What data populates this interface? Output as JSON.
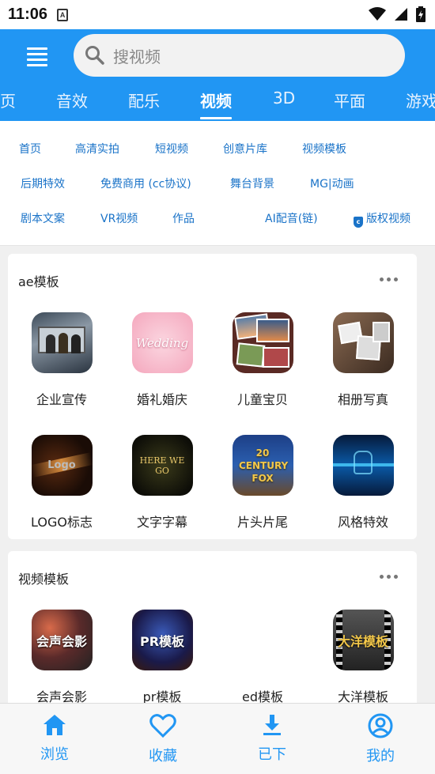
{
  "status_bar": {
    "time": "11:06",
    "app_icon_letter": "A"
  },
  "search": {
    "placeholder": "搜视频"
  },
  "tabs": [
    {
      "label": "页"
    },
    {
      "label": "音效"
    },
    {
      "label": "配乐"
    },
    {
      "label": "视频",
      "active": true
    },
    {
      "label": "3D"
    },
    {
      "label": "平面"
    },
    {
      "label": "游戏"
    }
  ],
  "categories": [
    {
      "label": "首页"
    },
    {
      "label": "高清实拍"
    },
    {
      "label": "短视频"
    },
    {
      "label": "创意片库"
    },
    {
      "label": "视频模板"
    },
    {
      "label": "后期特效"
    },
    {
      "label": "免费商用 (cc协议)"
    },
    {
      "label": "舞台背景"
    },
    {
      "label": "MG|动画"
    },
    {
      "label": "剧本文案"
    },
    {
      "label": "VR视频"
    },
    {
      "label": "作品"
    },
    {
      "label": "AI配音(链)"
    },
    {
      "label": "版权视频"
    }
  ],
  "sections": [
    {
      "title": "ae模板",
      "items": [
        {
          "label": "企业宣传"
        },
        {
          "label": "婚礼婚庆",
          "thumb_text": "Wedding"
        },
        {
          "label": "儿童宝贝"
        },
        {
          "label": "相册写真"
        },
        {
          "label": "LOGO标志",
          "thumb_text": "Logo"
        },
        {
          "label": "文字字幕",
          "thumb_text": "HERE WE GO"
        },
        {
          "label": "片头片尾",
          "thumb_text": "20 CENTURY FOX"
        },
        {
          "label": "风格特效"
        }
      ]
    },
    {
      "title": "视频模板",
      "items": [
        {
          "label": "会声会影",
          "thumb_text": "会声会影"
        },
        {
          "label": "pr模板",
          "thumb_text": "PR模板"
        },
        {
          "label": "ed模板"
        },
        {
          "label": "大洋模板",
          "thumb_text": "大洋模板"
        }
      ]
    }
  ],
  "bottom_nav": [
    {
      "label": "浏览",
      "icon": "home-icon"
    },
    {
      "label": "收藏",
      "icon": "heart-icon"
    },
    {
      "label": "已下",
      "icon": "download-icon"
    },
    {
      "label": "我的",
      "icon": "user-icon"
    }
  ],
  "colors": {
    "primary": "#2196F3",
    "link": "#1a73c8"
  }
}
